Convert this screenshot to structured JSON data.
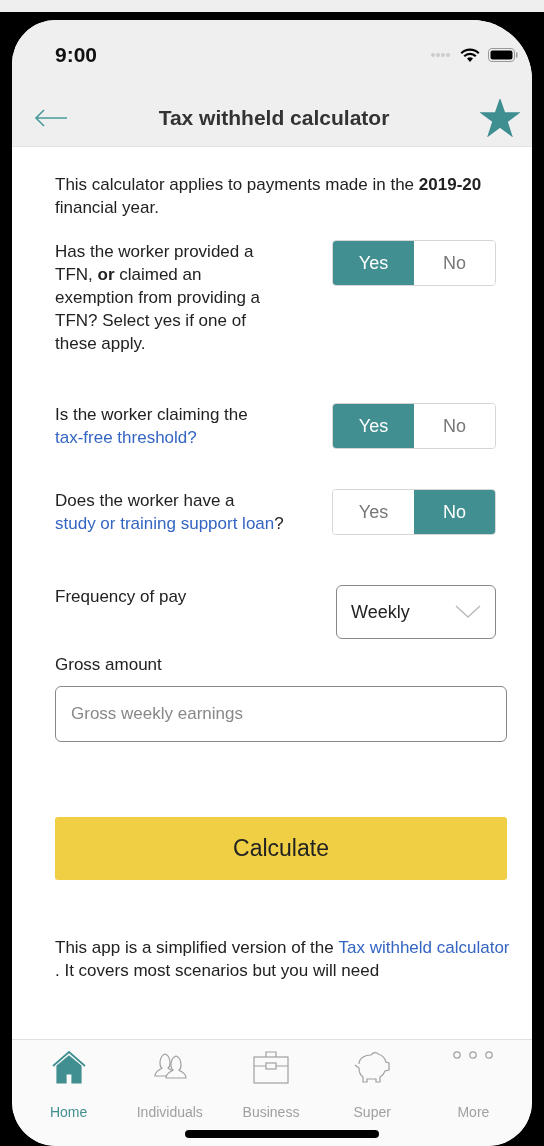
{
  "status_bar": {
    "time": "9:00"
  },
  "header": {
    "title": "Tax withheld calculator",
    "favorite": true
  },
  "intro": "This calculator applies to payments made in the **2019-20** financial year.",
  "questions": [
    {
      "parts": [
        {
          "kind": "text",
          "text": "Has the worker provided a TFN, **or** claimed an exemption from providing a TFN? Select yes if one of these apply."
        }
      ],
      "options": [
        {
          "label": "Yes",
          "selected": true
        },
        {
          "label": "No",
          "selected": false
        }
      ]
    },
    {
      "parts": [
        {
          "kind": "text",
          "text": "Is the worker claiming the "
        },
        {
          "kind": "link",
          "text": "tax-free threshold?"
        }
      ],
      "options": [
        {
          "label": "Yes",
          "selected": true
        },
        {
          "label": "No",
          "selected": false
        }
      ]
    },
    {
      "parts": [
        {
          "kind": "text",
          "text": "Does the worker have a "
        },
        {
          "kind": "link",
          "text": "study or training support loan"
        },
        {
          "kind": "text",
          "text": "?"
        }
      ],
      "options": [
        {
          "label": "Yes",
          "selected": false
        },
        {
          "label": "No",
          "selected": true
        }
      ]
    }
  ],
  "frequency": {
    "label": "Frequency of pay",
    "value": "Weekly"
  },
  "gross": {
    "label": "Gross amount",
    "placeholder": "Gross weekly earnings"
  },
  "calculate_button": "Calculate",
  "footer_parts": [
    {
      "kind": "text",
      "text": "This app is a simplified version of the "
    },
    {
      "kind": "link",
      "text": "Tax withheld calculator"
    },
    {
      "kind": "text",
      "text": ". It covers most scenarios but you will need"
    }
  ],
  "tab_bar": [
    {
      "label": "Home",
      "selected": true
    },
    {
      "label": "Individuals",
      "selected": false
    },
    {
      "label": "Business",
      "selected": false
    },
    {
      "label": "Super",
      "selected": false
    },
    {
      "label": "More",
      "selected": false
    }
  ]
}
